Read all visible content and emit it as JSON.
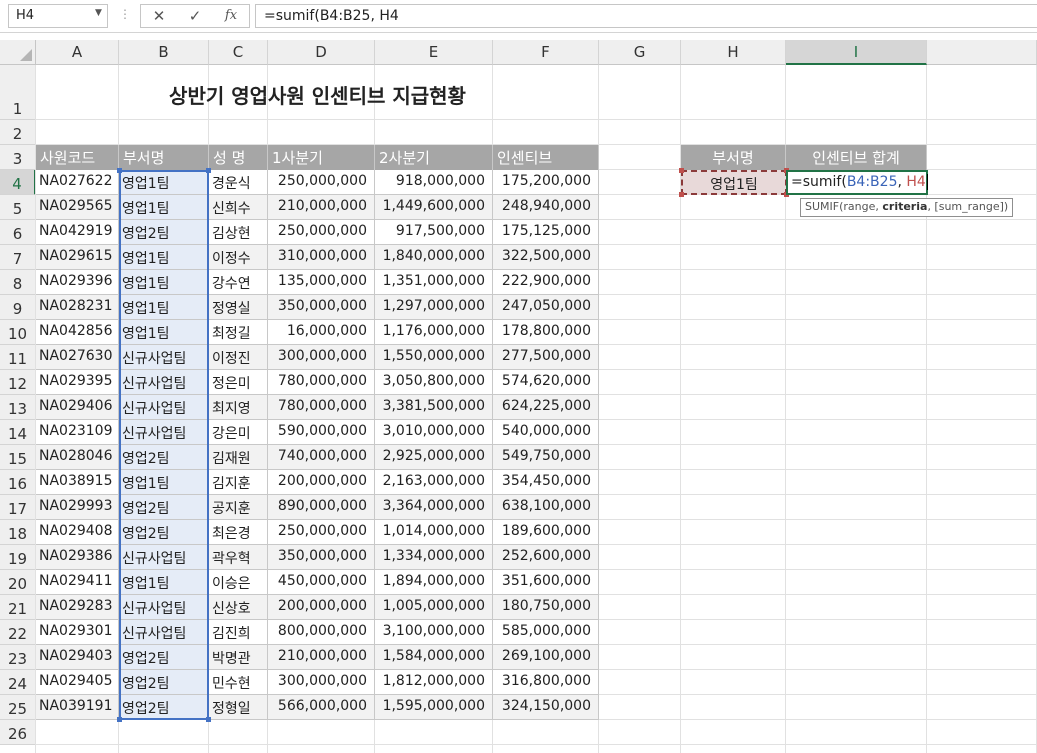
{
  "name_box": "H4",
  "formula_bar": {
    "cancel_icon": "✕",
    "enter_icon": "✓",
    "fx_label": "fx",
    "formula": "=sumif(B4:B25, H4"
  },
  "columns": [
    "A",
    "B",
    "C",
    "D",
    "E",
    "F",
    "G",
    "H",
    "I"
  ],
  "rows": [
    "1",
    "2",
    "3",
    "4",
    "5",
    "6",
    "7",
    "8",
    "9",
    "10",
    "11",
    "12",
    "13",
    "14",
    "15",
    "16",
    "17",
    "18",
    "19",
    "20",
    "21",
    "22",
    "23",
    "24",
    "25",
    "26"
  ],
  "sheet": {
    "title": "상반기 영업사원 인센티브 지급현황",
    "headers": [
      "사원코드",
      "부서명",
      "성  명",
      "1사분기",
      "2사분기",
      "인센티브"
    ],
    "data": [
      [
        "NA027622",
        "영업1팀",
        "경운식",
        "250,000,000",
        "918,000,000",
        "175,200,000"
      ],
      [
        "NA029565",
        "영업1팀",
        "신희수",
        "210,000,000",
        "1,449,600,000",
        "248,940,000"
      ],
      [
        "NA042919",
        "영업2팀",
        "김상현",
        "250,000,000",
        "917,500,000",
        "175,125,000"
      ],
      [
        "NA029615",
        "영업1팀",
        "이정수",
        "310,000,000",
        "1,840,000,000",
        "322,500,000"
      ],
      [
        "NA029396",
        "영업1팀",
        "강수연",
        "135,000,000",
        "1,351,000,000",
        "222,900,000"
      ],
      [
        "NA028231",
        "영업1팀",
        "정영실",
        "350,000,000",
        "1,297,000,000",
        "247,050,000"
      ],
      [
        "NA042856",
        "영업1팀",
        "최정길",
        "16,000,000",
        "1,176,000,000",
        "178,800,000"
      ],
      [
        "NA027630",
        "신규사업팀",
        "이정진",
        "300,000,000",
        "1,550,000,000",
        "277,500,000"
      ],
      [
        "NA029395",
        "신규사업팀",
        "정은미",
        "780,000,000",
        "3,050,800,000",
        "574,620,000"
      ],
      [
        "NA029406",
        "신규사업팀",
        "최지영",
        "780,000,000",
        "3,381,500,000",
        "624,225,000"
      ],
      [
        "NA023109",
        "신규사업팀",
        "강은미",
        "590,000,000",
        "3,010,000,000",
        "540,000,000"
      ],
      [
        "NA028046",
        "영업2팀",
        "김재원",
        "740,000,000",
        "2,925,000,000",
        "549,750,000"
      ],
      [
        "NA038915",
        "영업1팀",
        "김지훈",
        "200,000,000",
        "2,163,000,000",
        "354,450,000"
      ],
      [
        "NA029993",
        "영업2팀",
        "공지훈",
        "890,000,000",
        "3,364,000,000",
        "638,100,000"
      ],
      [
        "NA029408",
        "영업2팀",
        "최은경",
        "250,000,000",
        "1,014,000,000",
        "189,600,000"
      ],
      [
        "NA029386",
        "신규사업팀",
        "곽우혁",
        "350,000,000",
        "1,334,000,000",
        "252,600,000"
      ],
      [
        "NA029411",
        "영업1팀",
        "이승은",
        "450,000,000",
        "1,894,000,000",
        "351,600,000"
      ],
      [
        "NA029283",
        "신규사업팀",
        "신상호",
        "200,000,000",
        "1,005,000,000",
        "180,750,000"
      ],
      [
        "NA029301",
        "신규사업팀",
        "김진희",
        "800,000,000",
        "3,100,000,000",
        "585,000,000"
      ],
      [
        "NA029403",
        "영업2팀",
        "박명관",
        "210,000,000",
        "1,584,000,000",
        "269,100,000"
      ],
      [
        "NA029405",
        "영업2팀",
        "민수현",
        "300,000,000",
        "1,812,000,000",
        "316,800,000"
      ],
      [
        "NA039191",
        "영업2팀",
        "정형일",
        "566,000,000",
        "1,595,000,000",
        "324,150,000"
      ]
    ]
  },
  "summary": {
    "header_dept": "부서명",
    "header_total": "인센티브 합계",
    "dept_value": "영업1팀",
    "formula_prefix": "=sumif(",
    "formula_range": "B4:B25",
    "formula_sep": ", ",
    "formula_criteria": "H4"
  },
  "tooltip": {
    "fn": "SUMIF(range, ",
    "bold_arg": "criteria",
    "rest": ", [sum_range])"
  },
  "colors": {
    "header_bg": "#a6a6a6",
    "selected_green": "#217346",
    "range_blue": "#4472c4",
    "criteria_red": "#c0504d"
  }
}
